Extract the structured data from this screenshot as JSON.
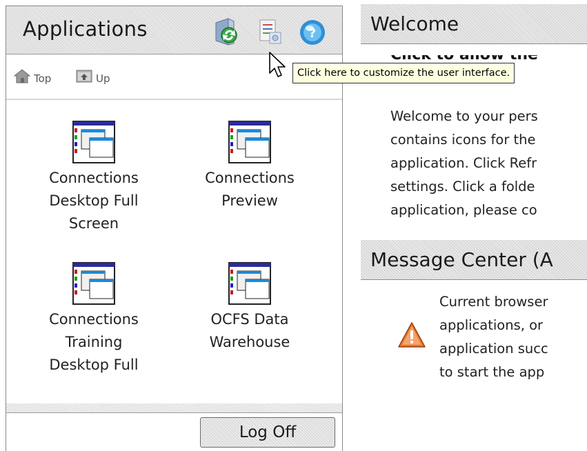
{
  "apps_panel": {
    "title": "Applications",
    "header_icons": [
      "refresh-icon",
      "customize-icon",
      "help-icon"
    ],
    "nav": {
      "top_label": "Top",
      "up_label": "Up"
    },
    "apps": [
      {
        "name": "Connections\nDesktop Full\nScreen"
      },
      {
        "name": "Connections\nPreview"
      },
      {
        "name": "Connections\nTraining\nDesktop Full"
      },
      {
        "name": "OCFS Data\nWarehouse"
      }
    ],
    "logoff_label": "Log Off"
  },
  "tooltip": {
    "text": "Click here to customize the user interface."
  },
  "welcome": {
    "title": "Welcome",
    "subtitle": "Click to allow the",
    "lines": [
      "Welcome to your pers",
      "contains icons for the",
      "application. Click Refr",
      "settings. Click a folde",
      "application, please co"
    ]
  },
  "message_center": {
    "title": "Message Center (A",
    "lines": [
      "Current browser",
      "applications, or",
      "application succ",
      "to start the app"
    ]
  },
  "colors": {
    "tooltip_bg": "#ffffe1",
    "header_stripe": "#d6d6d6",
    "warning_orange": "#e8772e"
  }
}
